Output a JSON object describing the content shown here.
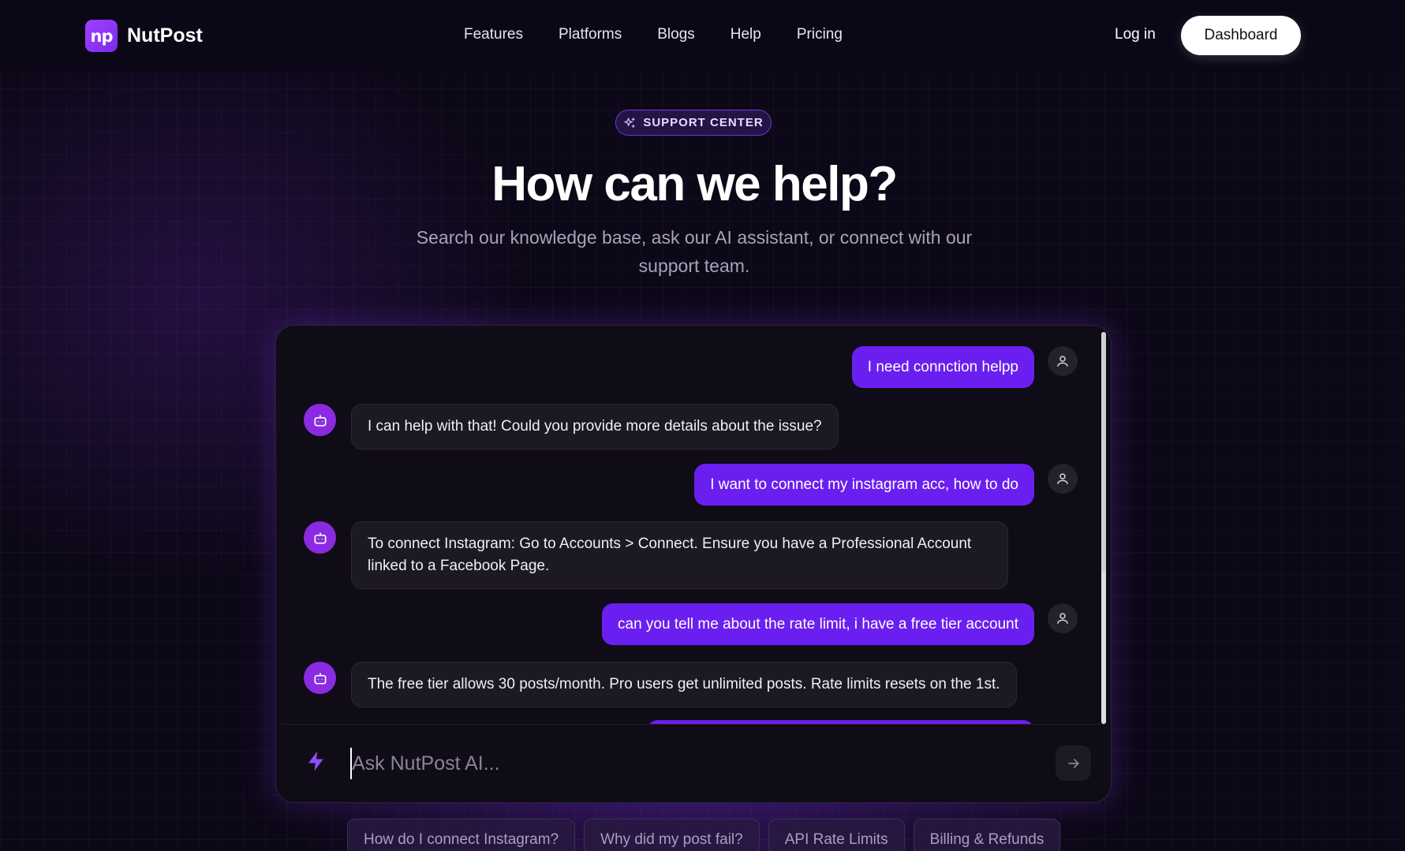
{
  "brand": {
    "logo_mark": "np",
    "name": "NutPost"
  },
  "nav": {
    "links": [
      "Features",
      "Platforms",
      "Blogs",
      "Help",
      "Pricing"
    ],
    "login": "Log in",
    "dashboard": "Dashboard"
  },
  "hero": {
    "badge": "SUPPORT CENTER",
    "badge_icon": "sparkles-icon",
    "title": "How can we help?",
    "subtitle": "Search our knowledge base, ask our AI assistant, or connect with our support team."
  },
  "chat": {
    "messages": [
      {
        "role": "user",
        "text": "I need connction helpp"
      },
      {
        "role": "bot",
        "text": "I can help with that! Could you provide more details about the issue?"
      },
      {
        "role": "user",
        "text": "I want to connect my instagram acc, how to do"
      },
      {
        "role": "bot",
        "text": "To connect Instagram: Go to Accounts > Connect. Ensure you have a Professional Account linked to a Facebook Page."
      },
      {
        "role": "user",
        "text": "can you tell me about the rate limit, i have a free tier account"
      },
      {
        "role": "bot",
        "text": "The free tier allows 30 posts/month. Pro users get unlimited posts. Rate limits resets on the 1st."
      }
    ],
    "input_placeholder": "Ask NutPost AI...",
    "accent": "#6a1ff0"
  },
  "suggestions": [
    "How do I connect Instagram?",
    "Why did my post fail?",
    "API Rate Limits",
    "Billing & Refunds"
  ]
}
